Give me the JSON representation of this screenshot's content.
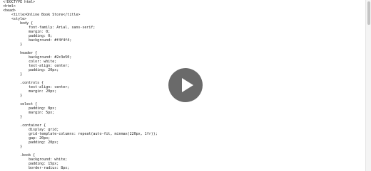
{
  "code_lines": [
    "<!DOCTYPE html>",
    "<html>",
    "<head>",
    "    <title>Online Book Store</title>",
    "    <style>",
    "        body {",
    "            font-family: Arial, sans-serif;",
    "            margin: 0;",
    "            padding: 0;",
    "            background: #f4f4f4;",
    "        }",
    "",
    "        header {",
    "            background: #2c3e50;",
    "            color: white;",
    "            text-align: center;",
    "            padding: 20px;",
    "        }",
    "",
    "        .controls {",
    "            text-align: center;",
    "            margin: 20px;",
    "        }",
    "",
    "        select {",
    "            padding: 8px;",
    "            margin: 5px;",
    "        }",
    "",
    "        .container {",
    "            display: grid;",
    "            grid-template-columns: repeat(auto-fit, minmax(220px, 1fr));",
    "            gap: 20px;",
    "            padding: 20px;",
    "        }",
    "",
    "        .book {",
    "            background: white;",
    "            padding: 15px;",
    "            border-radius: 8px;"
  ],
  "icons": {
    "play": "play-icon"
  },
  "colors": {
    "text": "#222222",
    "overlay": "#555555"
  }
}
